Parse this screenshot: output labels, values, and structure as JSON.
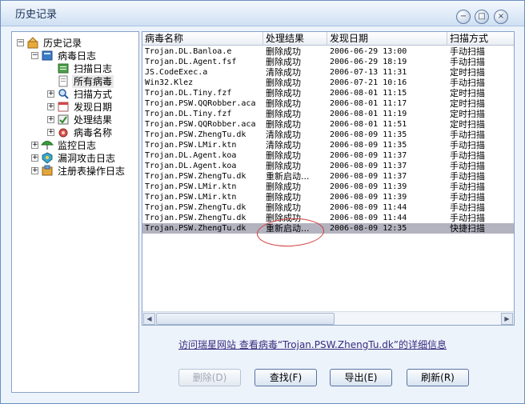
{
  "window": {
    "title": "历史记录"
  },
  "controls": {
    "minimize": "−",
    "maximize": "□",
    "close": "×"
  },
  "tree": [
    {
      "label": "历史记录",
      "expander": "−",
      "icon": "history-icon",
      "level": 0
    },
    {
      "label": "病毒日志",
      "expander": "−",
      "icon": "virus-log-icon",
      "level": 1
    },
    {
      "label": "扫描日志",
      "expander": "",
      "icon": "scan-log-icon",
      "level": 2
    },
    {
      "label": "所有病毒",
      "expander": "",
      "icon": "all-virus-icon",
      "level": 2,
      "selected": true
    },
    {
      "label": "扫描方式",
      "expander": "+",
      "icon": "scan-method-icon",
      "level": 2
    },
    {
      "label": "发现日期",
      "expander": "+",
      "icon": "calendar-icon",
      "level": 2
    },
    {
      "label": "处理结果",
      "expander": "+",
      "icon": "result-icon",
      "level": 2
    },
    {
      "label": "病毒名称",
      "expander": "+",
      "icon": "virus-name-icon",
      "level": 2
    },
    {
      "label": "监控日志",
      "expander": "+",
      "icon": "umbrella-icon",
      "level": 1
    },
    {
      "label": "漏洞攻击日志",
      "expander": "+",
      "icon": "vulnerability-icon",
      "level": 1
    },
    {
      "label": "注册表操作日志",
      "expander": "+",
      "icon": "registry-icon",
      "level": 1
    }
  ],
  "table": {
    "columns": [
      "病毒名称",
      "处理结果",
      "发现日期",
      "扫描方式"
    ],
    "rows": [
      [
        "Trojan.DL.Banloa.e",
        "删除成功",
        "2006-06-29 13:00",
        "手动扫描"
      ],
      [
        "Trojan.DL.Agent.fsf",
        "删除成功",
        "2006-06-29 18:19",
        "手动扫描"
      ],
      [
        "JS.CodeExec.a",
        "清除成功",
        "2006-07-13 11:31",
        "定时扫描"
      ],
      [
        "Win32.Klez",
        "删除成功",
        "2006-07-21 10:16",
        "手动扫描"
      ],
      [
        "Trojan.DL.Tiny.fzf",
        "删除成功",
        "2006-08-01 11:15",
        "定时扫描"
      ],
      [
        "Trojan.PSW.QQRobber.aca",
        "删除成功",
        "2006-08-01 11:17",
        "定时扫描"
      ],
      [
        "Trojan.DL.Tiny.fzf",
        "删除成功",
        "2006-08-01 11:19",
        "定时扫描"
      ],
      [
        "Trojan.PSW.QQRobber.aca",
        "删除成功",
        "2006-08-01 11:51",
        "定时扫描"
      ],
      [
        "Trojan.PSW.ZhengTu.dk",
        "清除成功",
        "2006-08-09 11:35",
        "手动扫描"
      ],
      [
        "Trojan.PSW.LMir.ktn",
        "清除成功",
        "2006-08-09 11:35",
        "手动扫描"
      ],
      [
        "Trojan.DL.Agent.koa",
        "删除成功",
        "2006-08-09 11:37",
        "手动扫描"
      ],
      [
        "Trojan.DL.Agent.koa",
        "删除成功",
        "2006-08-09 11:37",
        "手动扫描"
      ],
      [
        "Trojan.PSW.ZhengTu.dk",
        "重新启动...",
        "2006-08-09 11:37",
        "手动扫描"
      ],
      [
        "Trojan.PSW.LMir.ktn",
        "删除成功",
        "2006-08-09 11:39",
        "手动扫描"
      ],
      [
        "Trojan.PSW.LMir.ktn",
        "删除成功",
        "2006-08-09 11:39",
        "手动扫描"
      ],
      [
        "Trojan.PSW.ZhengTu.dk",
        "删除成功",
        "2006-08-09 11:44",
        "手动扫描"
      ],
      [
        "Trojan.PSW.ZhengTu.dk",
        "删除成功",
        "2006-08-09 11:44",
        "手动扫描"
      ],
      [
        "Trojan.PSW.ZhengTu.dk",
        "重新启动...",
        "2006-08-09 12:35",
        "快捷扫描"
      ]
    ],
    "selected_row": 17
  },
  "scroll": {
    "left": "◀",
    "right": "▶"
  },
  "link": {
    "text": "访问瑞星网站 查看病毒“Trojan.PSW.ZhengTu.dk”的详细信息"
  },
  "buttons": {
    "delete": "删除(D)",
    "find": "查找(F)",
    "export": "导出(E)",
    "refresh": "刷新(R)"
  },
  "colors": {
    "accent": "#6b8fbf",
    "selection": "#b3b3c0",
    "annotation": "#d23a3a"
  }
}
